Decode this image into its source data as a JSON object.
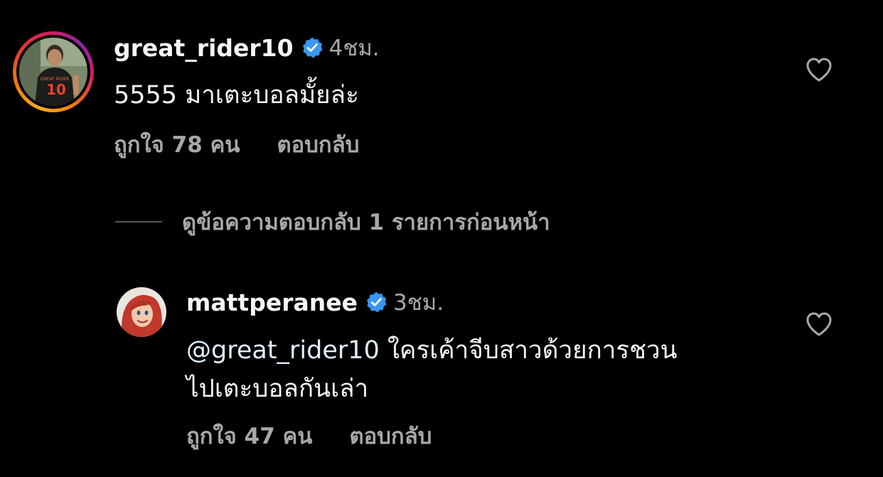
{
  "comments": [
    {
      "username": "great_rider10",
      "verified": true,
      "time": "4ชม.",
      "text": "5555 มาเตะบอลมั้ยล่ะ",
      "likes": "ถูกใจ 78 คน",
      "reply_label": "ตอบกลับ",
      "avatar_jersey_text": "GREAT RIDER",
      "avatar_jersey_number": "10"
    },
    {
      "username": "mattperanee",
      "verified": true,
      "time": "3ชม.",
      "mention": "@great_rider10",
      "text_line1": " ใครเค้าจีบสาวด้วยการชวน",
      "text_line2": "ไปเตะบอลกันเล่า",
      "likes": "ถูกใจ 47 คน",
      "reply_label": "ตอบกลับ"
    }
  ],
  "view_previous_replies": "ดูข้อความตอบกลับ 1 รายการก่อนหน้า",
  "icons": {
    "like": "heart-outline-icon",
    "verified": "verified-badge-icon"
  },
  "colors": {
    "background": "#000000",
    "primary_text": "#f5f5f5",
    "secondary_text": "#a8a8a8",
    "verified_blue": "#3897f0"
  }
}
